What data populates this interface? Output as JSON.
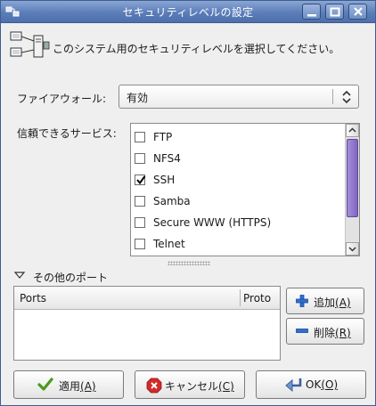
{
  "window": {
    "title": "セキュリティレベルの設定"
  },
  "header": {
    "description": "このシステム用のセキュリティレベルを選択してください。"
  },
  "firewall": {
    "label": "ファイアウォール:",
    "value": "有効"
  },
  "services": {
    "label": "信頼できるサービス:",
    "items": [
      {
        "name": "FTP",
        "checked": false
      },
      {
        "name": "NFS4",
        "checked": false
      },
      {
        "name": "SSH",
        "checked": true
      },
      {
        "name": "Samba",
        "checked": false
      },
      {
        "name": "Secure WWW (HTTPS)",
        "checked": false
      },
      {
        "name": "Telnet",
        "checked": false
      }
    ]
  },
  "other_ports": {
    "label": "その他のポート",
    "columns": [
      "Ports",
      "Proto"
    ],
    "add_label": "追加",
    "add_mnemonic": "(A)",
    "remove_label": "削除",
    "remove_mnemonic": "(R)"
  },
  "buttons": {
    "apply_label": "適用",
    "apply_mnemonic": "(A)",
    "cancel_label": "キャンセル",
    "cancel_mnemonic": "(C)",
    "ok_label": "OK",
    "ok_mnemonic": "(O)"
  },
  "colors": {
    "titlebar": "#5b7db8",
    "scroll_thumb": "#8065c2",
    "check_mark": "#000000",
    "add_icon": "#2f6fd0",
    "cancel_icon": "#d42a2a",
    "apply_icon": "#4a9a1f"
  }
}
